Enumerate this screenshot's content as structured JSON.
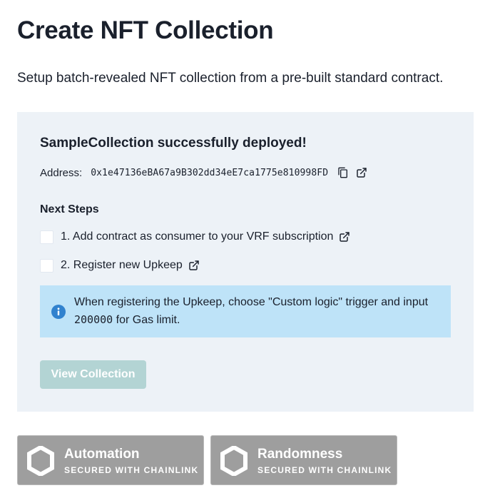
{
  "page": {
    "title": "Create NFT Collection",
    "subtitle": "Setup batch-revealed NFT collection from a pre-built standard contract."
  },
  "deploy": {
    "success_message": "SampleCollection successfully deployed!",
    "address_label": "Address:",
    "address_value": "0x1e47136eBA67a9B302dd34eE7ca1775e810998FD"
  },
  "next_steps": {
    "title": "Next Steps",
    "steps": [
      {
        "label": "1. Add contract as consumer to your VRF subscription",
        "checked": false
      },
      {
        "label": "2. Register new Upkeep",
        "checked": false
      }
    ]
  },
  "info": {
    "text_before": "When registering the Upkeep, choose \"Custom logic\" trigger and input ",
    "code": "200000",
    "text_after": " for Gas limit."
  },
  "actions": {
    "view_collection_label": "View Collection"
  },
  "badges": [
    {
      "title": "Automation",
      "subtitle": "SECURED WITH CHAINLINK"
    },
    {
      "title": "Randomness",
      "subtitle": "SECURED WITH CHAINLINK"
    }
  ],
  "colors": {
    "panel_bg": "#edf2f7",
    "info_bg": "#bee3f8",
    "info_icon": "#3182ce",
    "button_disabled": "#b3d4d4",
    "badge_bg": "#9e9e9e"
  },
  "icons": {
    "copy": "copy-icon",
    "external_link": "external-link-icon",
    "info": "info-icon",
    "chainlink": "chainlink-hexagon-logo"
  }
}
